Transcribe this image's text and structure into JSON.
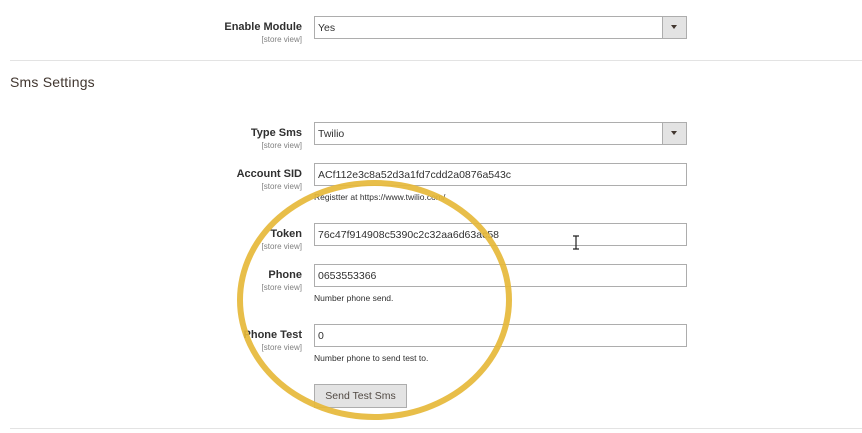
{
  "top": {
    "enable_module": {
      "label": "Enable Module",
      "scope": "[store view]",
      "value": "Yes"
    }
  },
  "section": {
    "title": "Sms Settings"
  },
  "fields": {
    "type_sms": {
      "label": "Type Sms",
      "scope": "[store view]",
      "value": "Twilio"
    },
    "account_sid": {
      "label": "Account SID",
      "scope": "[store view]",
      "value": "ACf112e3c8a52d3a1fd7cdd2a0876a543c",
      "note": "Registter at https://www.twilio.com/"
    },
    "token": {
      "label": "Token",
      "scope": "[store view]",
      "value": "76c47f914908c5390c2c32aa6d63ac58"
    },
    "phone": {
      "label": "Phone",
      "scope": "[store view]",
      "value": "0653553366",
      "note": "Number phone send."
    },
    "phone_test": {
      "label": "Phone Test",
      "scope": "[store view]",
      "value": "0",
      "note": "Number phone to send test to."
    }
  },
  "actions": {
    "send_test_label": "Send Test Sms"
  },
  "colors": {
    "highlight_circle": "#e6b93a",
    "button_bg": "#e3e3e3"
  }
}
